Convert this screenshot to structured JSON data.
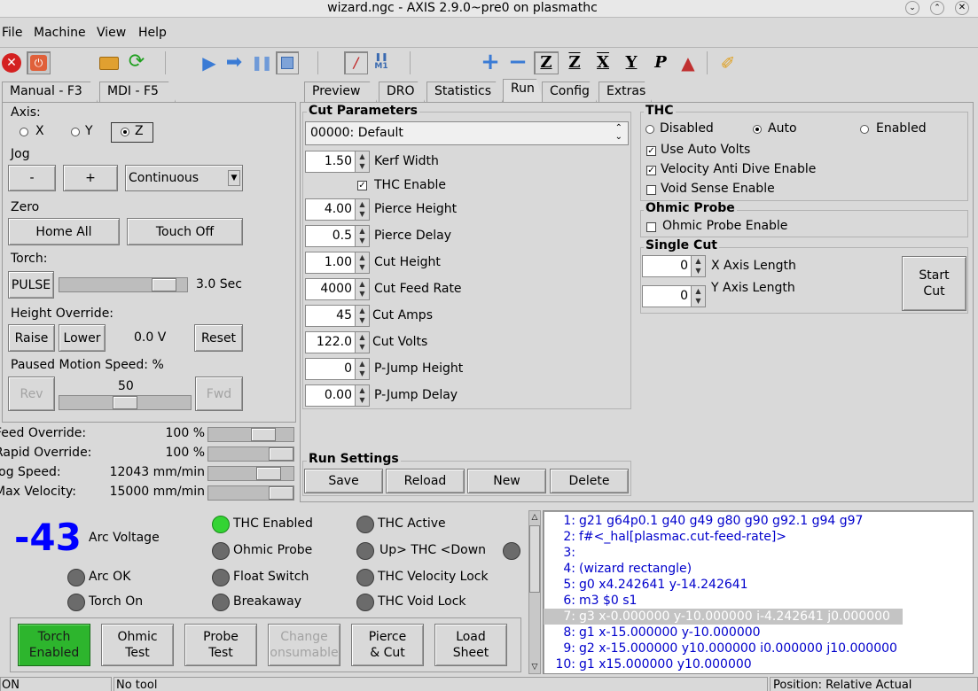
{
  "window": {
    "title": "wizard.ngc - AXIS 2.9.0~pre0 on plasmathc"
  },
  "menu": [
    "File",
    "Machine",
    "View",
    "Help"
  ],
  "toolbar_icons": [
    "estop-icon",
    "power-icon",
    "open-icon",
    "reload-icon",
    "run-icon",
    "step-icon",
    "pause-icon",
    "stop-icon",
    "block-delete-icon",
    "optional-stop-icon",
    "zoom-in-icon",
    "zoom-out-icon",
    "view-z-icon",
    "view-z2-icon",
    "view-x-icon",
    "view-y-icon",
    "view-p-icon",
    "rotate-icon",
    "clear-icon"
  ],
  "left_tabs": [
    "Manual - F3",
    "MDI - F5"
  ],
  "right_tabs": [
    "Preview",
    "DRO",
    "Statistics",
    "Run",
    "Config",
    "Extras"
  ],
  "manual": {
    "axis_label": "Axis:",
    "axes": [
      "X",
      "Y",
      "Z"
    ],
    "jog_label": "Jog",
    "jog_minus": "-",
    "jog_plus": "+",
    "jog_mode": "Continuous",
    "zero_label": "Zero",
    "home_all": "Home All",
    "touch_off": "Touch Off",
    "torch_label": "Torch:",
    "pulse": "PULSE",
    "pulse_time": "3.0 Sec",
    "pulse_level": 0.9,
    "height_override_label": "Height Override:",
    "raise": "Raise",
    "lower": "Lower",
    "height_value": "0.0 V",
    "reset": "Reset",
    "paused_motion_label": "Paused Motion Speed: %",
    "rev": "Rev",
    "fwd": "Fwd",
    "paused_value": "50",
    "paused_level": 0.5
  },
  "overrides": [
    {
      "label": "Feed Override:",
      "value": "100 %",
      "level": 0.7
    },
    {
      "label": "Rapid Override:",
      "value": "100 %",
      "level": 1.0
    },
    {
      "label": "Jog Speed:",
      "value": "12043 mm/min",
      "level": 0.8
    },
    {
      "label": "Max Velocity:",
      "value": "15000 mm/min",
      "level": 1.0
    }
  ],
  "cut_parameters": {
    "title": "Cut Parameters",
    "material": "00000: Default",
    "kerf_width": {
      "value": "1.50",
      "label": "Kerf Width"
    },
    "thc_enable": "THC Enable",
    "pierce_height": {
      "value": "4.00",
      "label": "Pierce Height"
    },
    "pierce_delay": {
      "value": "0.5",
      "label": "Pierce Delay"
    },
    "cut_height": {
      "value": "1.00",
      "label": "Cut Height"
    },
    "cut_feed_rate": {
      "value": "4000",
      "label": "Cut Feed Rate"
    },
    "cut_amps": {
      "value": "45",
      "label": "Cut Amps"
    },
    "cut_volts": {
      "value": "122.0",
      "label": "Cut Volts"
    },
    "pjump_height": {
      "value": "0",
      "label": "P-Jump Height"
    },
    "pjump_delay": {
      "value": "0.00",
      "label": "P-Jump Delay"
    }
  },
  "run_settings": {
    "title": "Run Settings",
    "save": "Save",
    "reload": "Reload",
    "new": "New",
    "delete": "Delete"
  },
  "thc": {
    "title": "THC",
    "disabled": "Disabled",
    "auto": "Auto",
    "enabled": "Enabled",
    "use_auto_volts": "Use Auto Volts",
    "velocity_anti_dive": "Velocity Anti Dive Enable",
    "void_sense": "Void Sense Enable"
  },
  "ohmic_probe": {
    "title": "Ohmic Probe",
    "enable": "Ohmic Probe Enable"
  },
  "single_cut": {
    "title": "Single Cut",
    "x_value": "0",
    "x_label": "X Axis Length",
    "y_value": "0",
    "y_label": "Y Axis Length",
    "start": "Start\nCut"
  },
  "status": {
    "arc_voltage_value": "-43",
    "arc_voltage_label": "Arc Voltage",
    "arc_ok": "Arc OK",
    "torch_on": "Torch On",
    "thc_enabled": "THC Enabled",
    "ohmic_probe": "Ohmic Probe",
    "float_switch": "Float Switch",
    "breakaway": "Breakaway",
    "thc_active": "THC Active",
    "up_down": "Up> THC <Down",
    "thc_velocity_lock": "THC Velocity Lock",
    "thc_void_lock": "THC Void Lock"
  },
  "bottom_buttons": {
    "torch_enabled": "Torch\nEnabled",
    "ohmic_test": "Ohmic\nTest",
    "probe_test": "Probe\nTest",
    "change_consumable": "Change\nonsumable",
    "pierce_cut": "Pierce\n& Cut",
    "load_sheet": "Load\nSheet"
  },
  "gcode": [
    {
      "n": "1:",
      "text": "g21 g64p0.1 g40 g49 g80 g90 g92.1 g94 g97"
    },
    {
      "n": "2:",
      "text": "f#<_hal[plasmac.cut-feed-rate]>"
    },
    {
      "n": "3:",
      "text": ""
    },
    {
      "n": "4:",
      "text": "(wizard rectangle)"
    },
    {
      "n": "5:",
      "text": "g0 x4.242641 y-14.242641"
    },
    {
      "n": "6:",
      "text": "m3 $0 s1"
    },
    {
      "n": "7:",
      "text": "g3 x-0.000000 y-10.000000 i-4.242641 j0.000000"
    },
    {
      "n": "8:",
      "text": "g1 x-15.000000 y-10.000000"
    },
    {
      "n": "9:",
      "text": "g2 x-15.000000 y10.000000 i0.000000 j10.000000"
    },
    {
      "n": "10:",
      "text": "g1 x15.000000 y10.000000"
    }
  ],
  "statusbar": {
    "state": "ON",
    "tool": "No tool",
    "position": "Position: Relative Actual"
  },
  "colors": {
    "gcode": "#0000cc",
    "arc_voltage": "#0000ff",
    "led_on": "#34d434",
    "torch_enabled_bg": "#2db52d"
  }
}
